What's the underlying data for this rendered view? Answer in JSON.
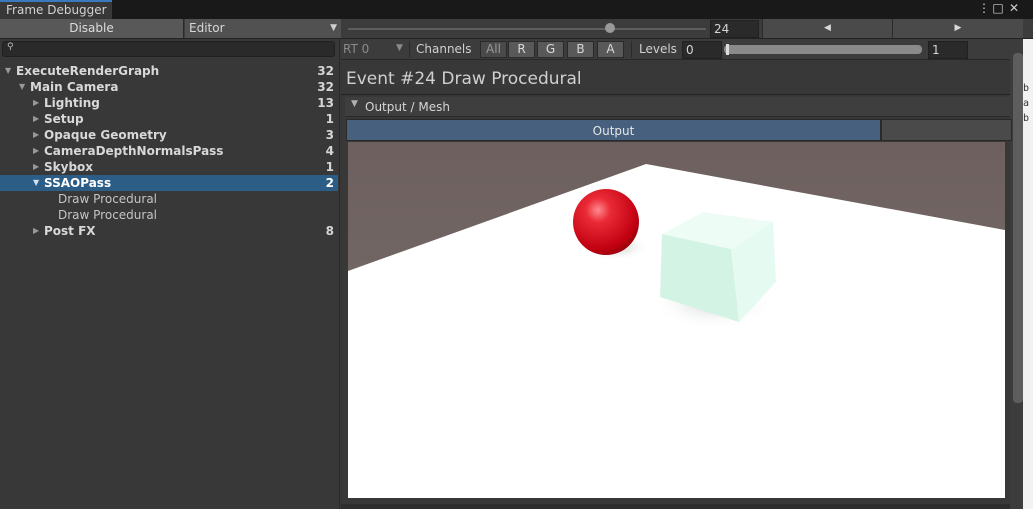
{
  "window": {
    "tab_title": "Frame Debugger",
    "menu_icon": "kebab-menu-icon",
    "maximize_icon": "maximize-icon",
    "close_icon": "close-icon"
  },
  "toolbar": {
    "disable_label": "Disable",
    "target_dropdown": "Editor",
    "event_index": "24",
    "prev_icon": "◀",
    "next_icon": "▶"
  },
  "search": {
    "placeholder": ""
  },
  "tree": [
    {
      "label": "ExecuteRenderGraph",
      "count": "32",
      "bold": true
    },
    {
      "label": "Main Camera",
      "count": "32",
      "bold": true
    },
    {
      "label": "Lighting",
      "count": "13",
      "bold": true
    },
    {
      "label": "Setup",
      "count": "1",
      "bold": true
    },
    {
      "label": "Opaque Geometry",
      "count": "3",
      "bold": true
    },
    {
      "label": "CameraDepthNormalsPass",
      "count": "4",
      "bold": true
    },
    {
      "label": "Skybox",
      "count": "1",
      "bold": true
    },
    {
      "label": "SSAOPass",
      "count": "2",
      "bold": true
    },
    {
      "label": "Draw Procedural",
      "count": "",
      "bold": false
    },
    {
      "label": "Draw Procedural",
      "count": "",
      "bold": false
    },
    {
      "label": "Post FX",
      "count": "8",
      "bold": true
    }
  ],
  "detail": {
    "rt_label": "RT 0",
    "channels_label": "Channels",
    "channels": [
      "All",
      "R",
      "G",
      "B",
      "A"
    ],
    "levels_label": "Levels",
    "levels_min": "0",
    "levels_max": "1",
    "event_title": "Event #24 Draw Procedural",
    "section_title": "Output / Mesh",
    "output_tab": "Output"
  },
  "edge_text": [
    "b",
    "a",
    "b"
  ],
  "colors": {
    "selection": "#2c5d87",
    "output_tab": "#46607d",
    "sphere": "#e0111c",
    "cube": "#d9f4e9"
  }
}
